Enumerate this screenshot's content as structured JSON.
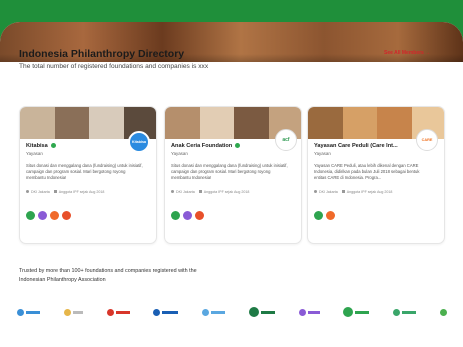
{
  "header": {
    "title": "Indonesia Philanthropy Directory",
    "subtitle": "The total number of registered foundations and companies is xxx",
    "see_all": "See All Members →"
  },
  "cards": [
    {
      "name": "Kitabisa",
      "type": "Yayasan",
      "logo_text": "Kitabisa",
      "description": "Situs donasi dan menggalang dana (fundraising) untuk inisiatif, campaign dan program sosial. Mari bergotong royong membantu Indonesia!",
      "location": "DKI Jakarta",
      "member_since": "Anggota IPF sejak Aug 2018",
      "accent": "#2b8be0"
    },
    {
      "name": "Anak Ceria Foundation",
      "type": "Yayasan",
      "logo_text": "acf",
      "description": "Situs donasi dan menggalang dana (fundraising) untuk inisiatif, campaign dan program sosial. Mari bergotong royong membantu Indonesia!",
      "location": "DKI Jakarta",
      "member_since": "Anggota IPF sejak Aug 2018",
      "accent": "#2f9a52"
    },
    {
      "name": "Yayasan Care Peduli (Care Int...",
      "type": "Yayasan",
      "logo_text": "CARE",
      "description": "Yayasan CARE Peduli, atau lebih dikenal dengan CARE Indonesia, didirikan pada bulan Juli 2018 sebagai bentuk entitas CARE di Indonesia. Progra...",
      "location": "DKI Jakarta",
      "member_since": "Anggota IPF sejak Aug 2018",
      "accent": "#f0701e"
    }
  ],
  "trusted_text": "Trusted by more than 100+ foundations and companies registered with the Indonesian Philanthropy Association",
  "colors": {
    "brand_green": "#1f8f3a",
    "see_all_red": "#d1262a",
    "dot_green": "#2ea44f",
    "dot_purple": "#8a5bd6",
    "dot_orange": "#f06a2a",
    "dot_red": "#e8502a"
  }
}
